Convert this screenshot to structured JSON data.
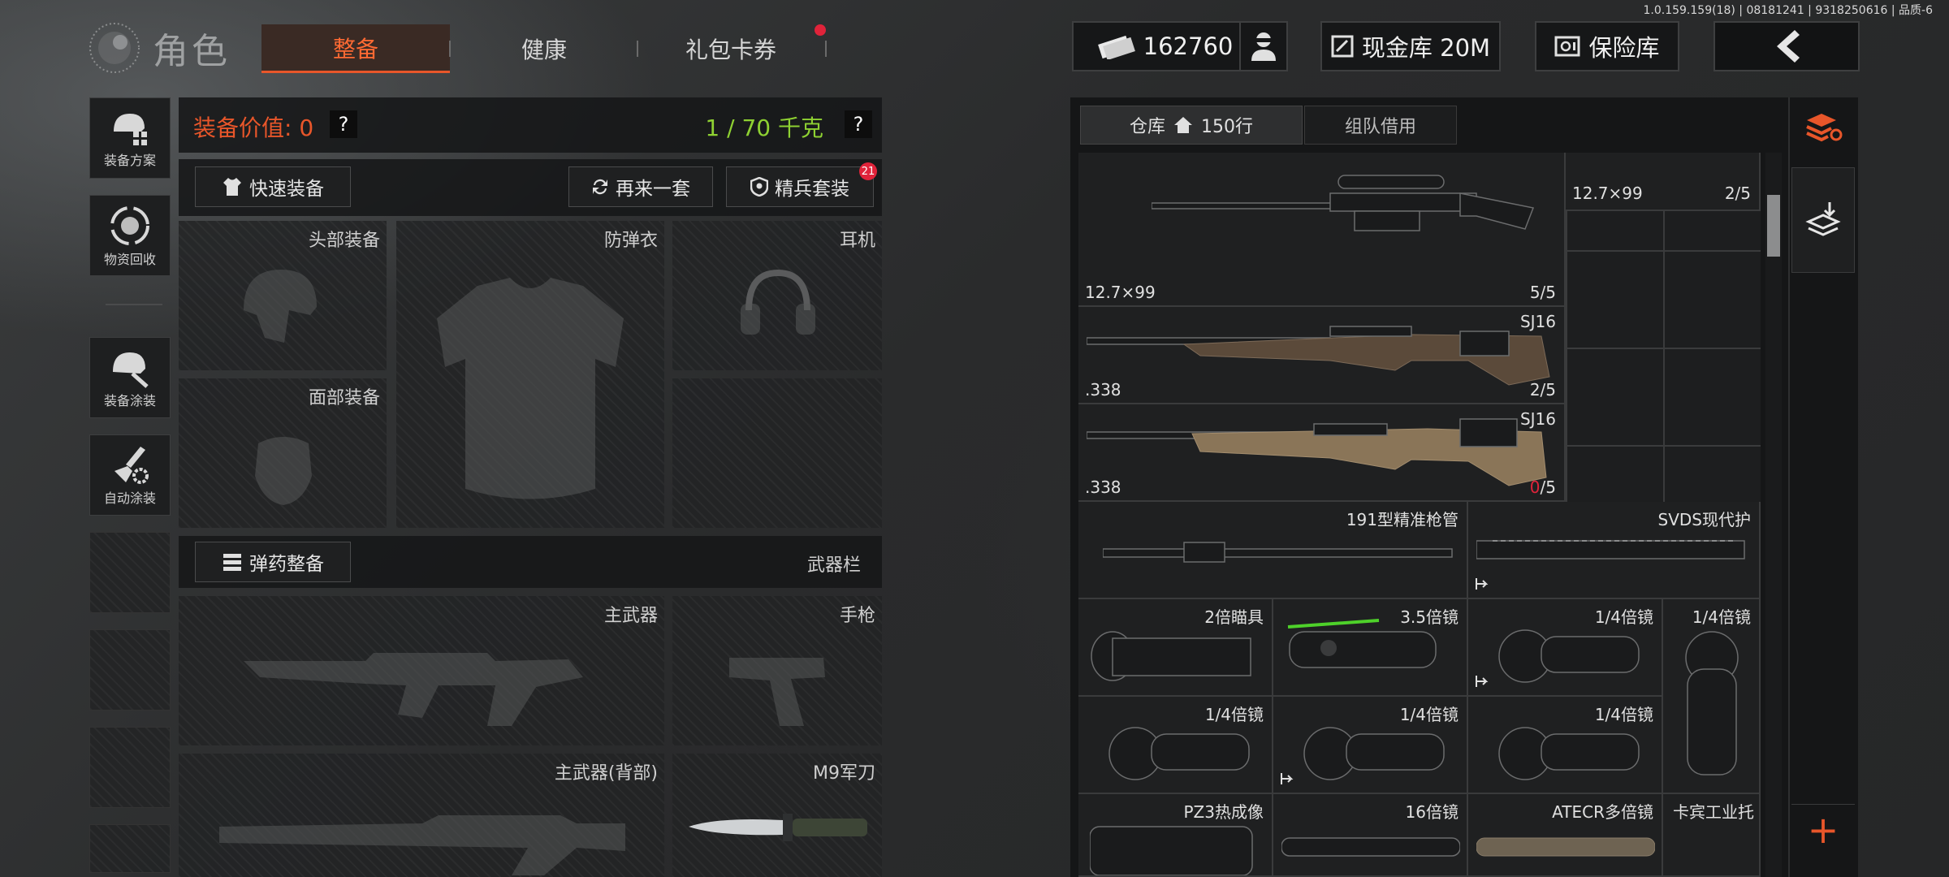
{
  "version": "1.0.159.159(18) | 08181241 | 9318250616 | 品质-6",
  "header": {
    "title": "角色",
    "tabs": [
      {
        "label": "整备",
        "active": true
      },
      {
        "label": "健康",
        "active": false
      },
      {
        "label": "礼包卡券",
        "active": false,
        "badge_dot": true
      }
    ],
    "currency": "162760",
    "cash_vault": "现金库 20M",
    "safe_vault": "保险库"
  },
  "side_nav": [
    {
      "label": "装备方案",
      "icon": "helmet-grid-icon"
    },
    {
      "label": "物资回收",
      "icon": "recycle-icon"
    },
    {
      "label": "装备涂装",
      "icon": "helmet-paint-icon"
    },
    {
      "label": "自动涂装",
      "icon": "brush-gear-icon"
    }
  ],
  "loadout": {
    "value_label": "装备价值: 0",
    "weight_label": "1 / 70 千克",
    "help": "?",
    "quick_equip": "快速装备",
    "repeat_set": "再来一套",
    "elite_set": "精兵套装",
    "elite_badge": "21",
    "slots": {
      "head": "头部装备",
      "armor": "防弹衣",
      "headset": "耳机",
      "face": "面部装备",
      "ammo_button": "弹药整备",
      "weapon_bar": "武器栏",
      "primary": "主武器",
      "pistol": "手枪",
      "primary_back": "主武器(背部)",
      "knife": "M9军刀"
    }
  },
  "warehouse": {
    "tab_warehouse": "仓库",
    "rows": "150行",
    "tab_team": "组队借用",
    "items": [
      {
        "name": "",
        "caliber": "12.7×99",
        "durability": "5/5"
      },
      {
        "name": "",
        "caliber": "12.7×99",
        "durability": "2/5"
      },
      {
        "name": "SJ16",
        "caliber": ".338",
        "durability": "2/5"
      },
      {
        "name": "SJ16",
        "caliber": ".338",
        "durability_low": "0",
        "durability_rest": "/5"
      },
      {
        "name": "191型精准枪管"
      },
      {
        "name": "SVDS现代护"
      },
      {
        "name": "2倍瞄具"
      },
      {
        "name": "3.5倍镜"
      },
      {
        "name": "1/4倍镜"
      },
      {
        "name": "1/4倍镜"
      },
      {
        "name": "1/4倍镜"
      },
      {
        "name": "1/4倍镜"
      },
      {
        "name": "1/4倍镜"
      },
      {
        "name": "PZ3热成像"
      },
      {
        "name": "16倍镜"
      },
      {
        "name": "ATECR多倍镜"
      },
      {
        "name": "卡宾工业托"
      }
    ],
    "add": "+"
  },
  "colors": {
    "accent": "#e8562a",
    "weight_green": "#8ed132",
    "low_red": "#e0233a"
  }
}
